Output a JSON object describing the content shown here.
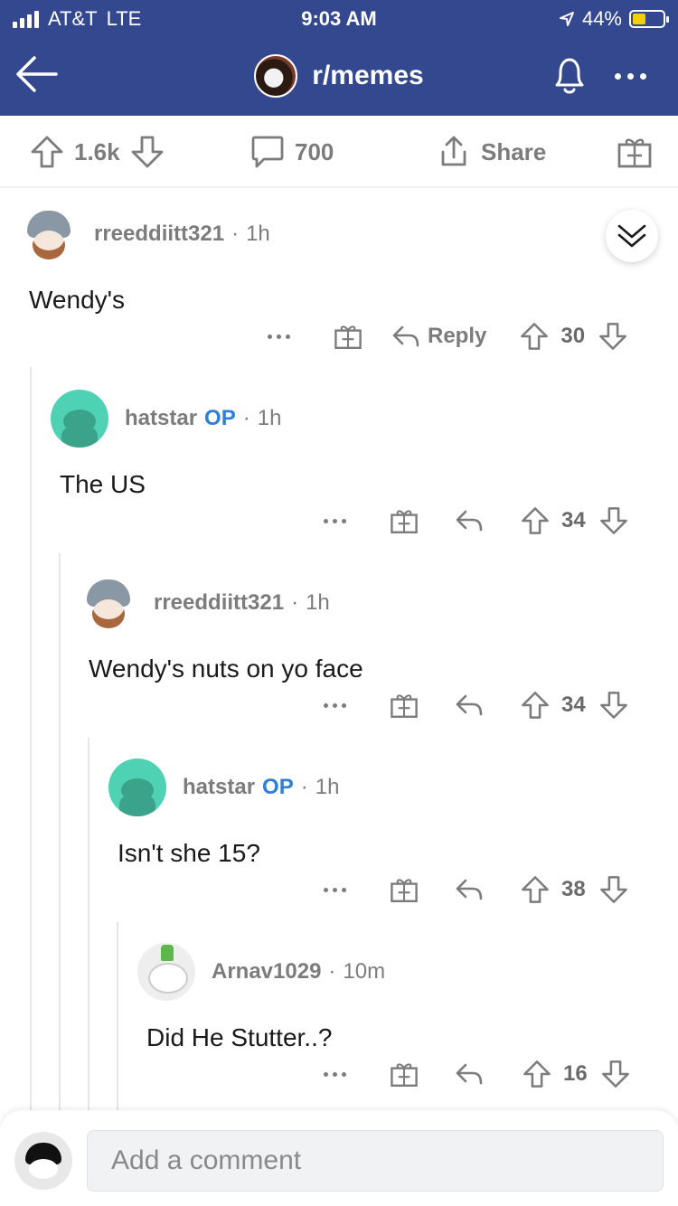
{
  "status_bar": {
    "carrier": "AT&T",
    "network": "LTE",
    "time": "9:03 AM",
    "battery": "44%",
    "battery_level": 0.44
  },
  "header": {
    "community": "r/memes"
  },
  "post_actions": {
    "upvotes": "1.6k",
    "comments": "700",
    "share": "Share"
  },
  "comments": [
    {
      "user": "rreeddiitt321",
      "op": "",
      "age": "1h",
      "body": "Wendy's",
      "votes": "30",
      "reply": "Reply"
    },
    {
      "user": "hatstar",
      "op": "OP",
      "age": "1h",
      "body": "The US",
      "votes": "34"
    },
    {
      "user": "rreeddiitt321",
      "op": "",
      "age": "1h",
      "body": "Wendy's nuts on yo face",
      "votes": "34"
    },
    {
      "user": "hatstar",
      "op": "OP",
      "age": "1h",
      "body": "Isn't she 15?",
      "votes": "38"
    },
    {
      "user": "Arnav1029",
      "op": "",
      "age": "10m",
      "body": "Did He Stutter..?",
      "votes": "16"
    }
  ],
  "composer": {
    "placeholder": "Add a comment"
  },
  "colors": {
    "header_bg": "#34488f",
    "op_blue": "#2f7fd6",
    "battery": "#f5d000",
    "meta_gray": "#7c7c7c"
  }
}
